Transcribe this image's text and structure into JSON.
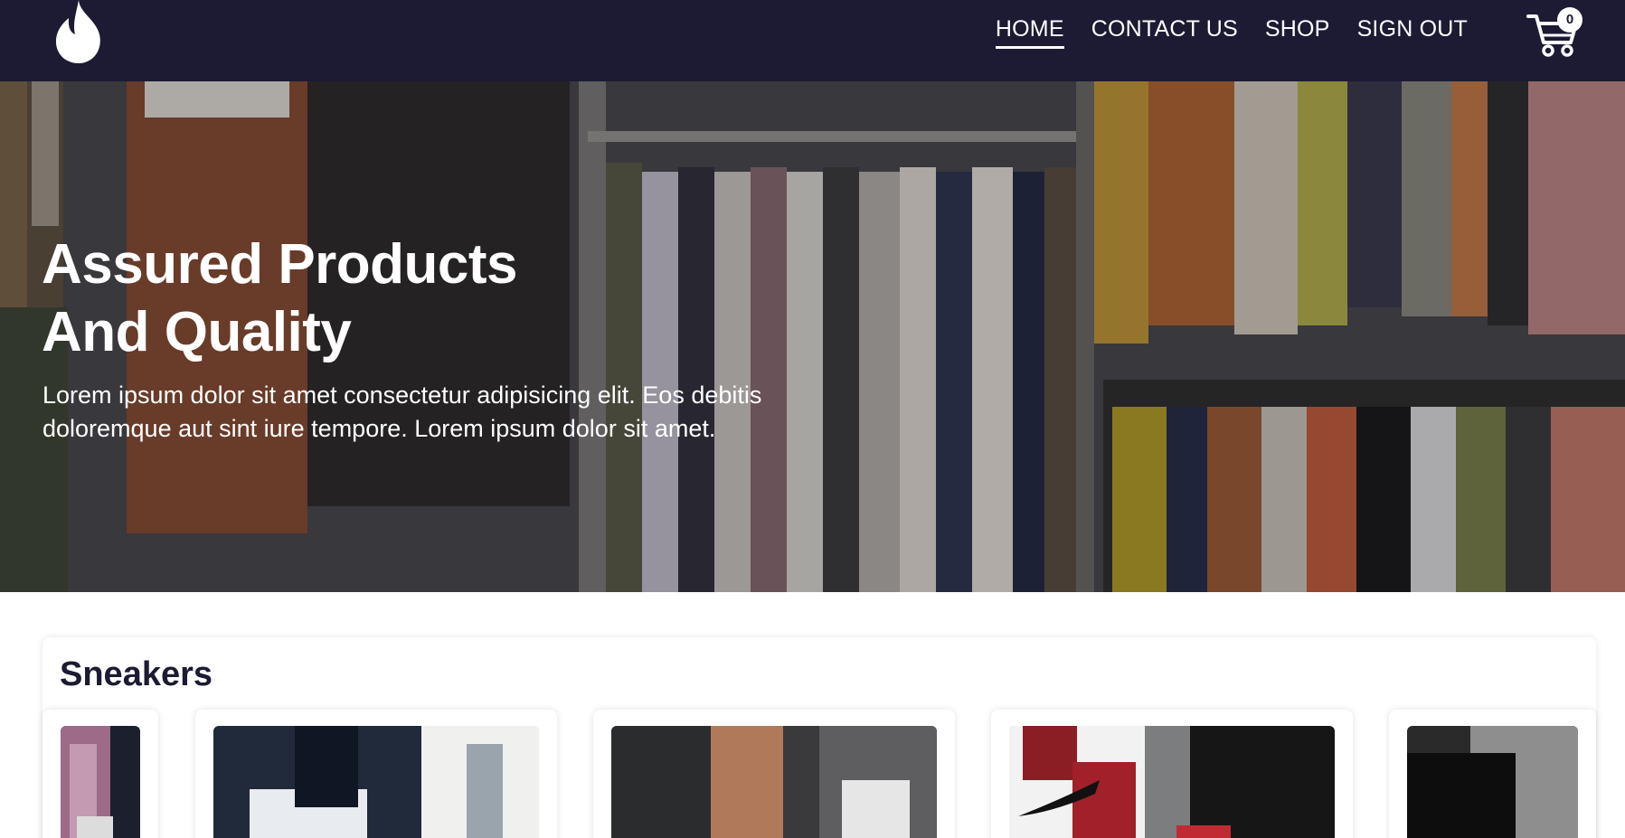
{
  "nav": {
    "logo_icon": "flame-icon",
    "links": [
      {
        "label": "HOME",
        "active": true
      },
      {
        "label": "CONTACT US",
        "active": false
      },
      {
        "label": "SHOP",
        "active": false
      },
      {
        "label": "SIGN OUT",
        "active": false
      }
    ],
    "cart_icon": "cart-icon",
    "cart_count": "0"
  },
  "hero": {
    "title": "Assured Products And Quality",
    "text": "Lorem ipsum dolor sit amet consectetur adipisicing elit. Eos debitis doloremque aut sint iure tempore. Lorem ipsum dolor sit amet."
  },
  "section": {
    "title": "Sneakers"
  },
  "colors": {
    "navbar": "#1c1b33",
    "text_light": "#ffffff",
    "section_title": "#1c1b33"
  }
}
